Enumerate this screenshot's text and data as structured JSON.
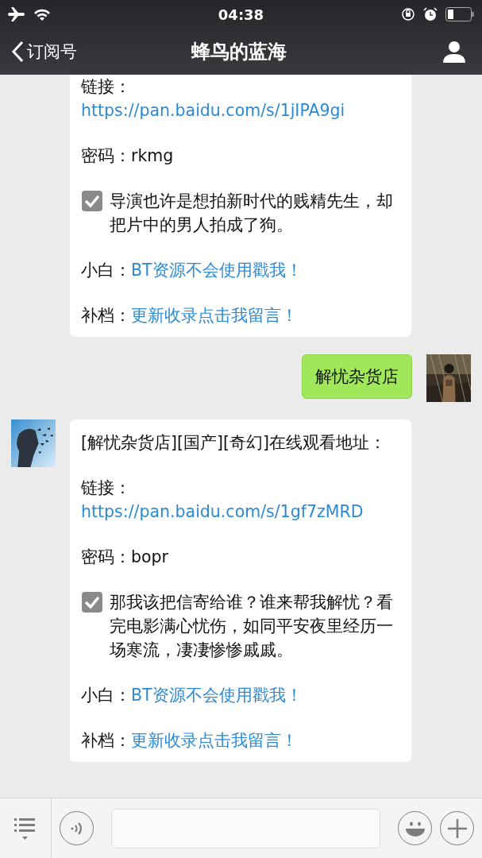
{
  "status_bar": {
    "time": "04:38"
  },
  "nav": {
    "back_label": "订阅号",
    "title": "蜂鸟的蓝海"
  },
  "messages": [
    {
      "kind": "received",
      "show_avatar": false,
      "paragraphs": [
        {
          "kind": "link",
          "label": "链接：",
          "url": "https://pan.baidu.com/s/1jIPA9gi"
        },
        {
          "kind": "field",
          "label": "密码：",
          "value": "rkmg"
        },
        {
          "kind": "check",
          "text": "导演也许是想拍新时代的贱精先生，却把片中的男人拍成了狗。"
        },
        {
          "kind": "field_link",
          "label": "小白：",
          "link": "BT资源不会使用戳我！"
        },
        {
          "kind": "field_link",
          "label": "补档：",
          "link": "更新收录点击我留言！"
        }
      ]
    },
    {
      "kind": "sent",
      "show_avatar": true,
      "paragraphs": [
        {
          "kind": "text",
          "text": "解忧杂货店"
        }
      ]
    },
    {
      "kind": "received",
      "show_avatar": true,
      "paragraphs": [
        {
          "kind": "text",
          "text": "[解忧杂货店][国产][奇幻]在线观看地址："
        },
        {
          "kind": "link",
          "label": "链接：",
          "url": "https://pan.baidu.com/s/1gf7zMRD"
        },
        {
          "kind": "field",
          "label": "密码：",
          "value": "bopr"
        },
        {
          "kind": "check",
          "text": "那我该把信寄给谁？谁来帮我解忧？看完电影满心忧伤，如同平安夜里经历一场寒流，凄凄惨惨戚戚。"
        },
        {
          "kind": "field_link",
          "label": "小白：",
          "link": "BT资源不会使用戳我！"
        },
        {
          "kind": "field_link",
          "label": "补档：",
          "link": "更新收录点击我留言！"
        }
      ]
    }
  ]
}
